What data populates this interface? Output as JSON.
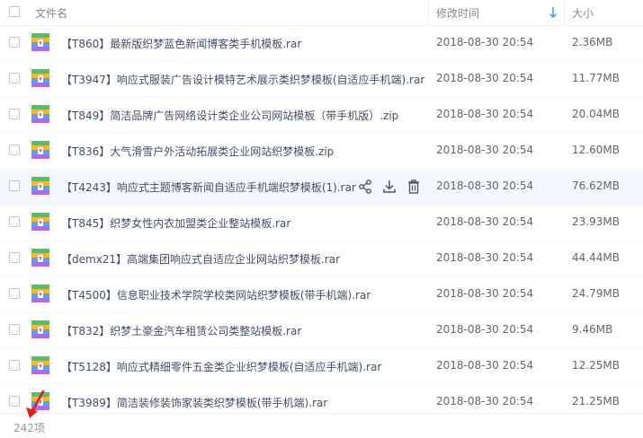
{
  "header": {
    "name_label": "文件名",
    "date_label": "修改时间",
    "size_label": "大小"
  },
  "files": [
    {
      "name": "【T860】最新版织梦蓝色新闻博客类手机模板.rar",
      "date": "2018-08-30 20:54",
      "size": "2.36MB"
    },
    {
      "name": "【T3947】响应式服装广告设计模特艺术展示类织梦模板(自适应手机端).rar",
      "date": "2018-08-30 20:54",
      "size": "11.77MB"
    },
    {
      "name": "【T849】简洁品牌广告网络设计类企业公司网站模板（带手机版）.zip",
      "date": "2018-08-30 20:54",
      "size": "20.04MB"
    },
    {
      "name": "【T836】大气滑雪户外活动拓展类企业网站织梦模板.zip",
      "date": "2018-08-30 20:54",
      "size": "12.60MB"
    },
    {
      "name": "【T4243】响应式主题博客新闻自适应手机端织梦模板(1).rar",
      "date": "2018-08-30 20:54",
      "size": "76.62MB"
    },
    {
      "name": "【T845】织梦女性内衣加盟类企业整站模板.rar",
      "date": "2018-08-30 20:54",
      "size": "23.93MB"
    },
    {
      "name": "【demx21】高端集团响应式自适应企业网站织梦模板.rar",
      "date": "2018-08-30 20:54",
      "size": "44.44MB"
    },
    {
      "name": "【T4500】信息职业技术学院学校类网站织梦模板(带手机端).rar",
      "date": "2018-08-30 20:54",
      "size": "24.79MB"
    },
    {
      "name": "【T832】织梦土豪金汽车租赁公司类整站模板.rar",
      "date": "2018-08-30 20:54",
      "size": "9.46MB"
    },
    {
      "name": "【T5128】响应式精细零件五金类企业织梦模板(自适应手机端).rar",
      "date": "2018-08-30 20:54",
      "size": "12.25MB"
    },
    {
      "name": "【T3989】简洁装修装饰家装类织梦模板(带手机端).rar",
      "date": "2018-08-30 20:54",
      "size": "21.25MB"
    }
  ],
  "hover_row_index": 4,
  "footer": {
    "count": "242项"
  },
  "icons": {
    "file": "archive-file-icon",
    "share": "share-icon",
    "download": "download-icon",
    "delete": "trash-icon",
    "sort": "sort-arrow-down-icon"
  },
  "colors": {
    "accent": "#3b8cff",
    "hover_row": "#f4f8fe",
    "annotation": "#e02020"
  }
}
